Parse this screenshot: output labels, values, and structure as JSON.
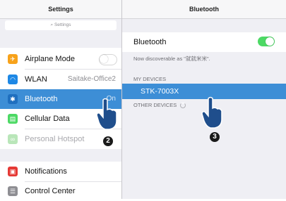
{
  "left_pane": {
    "title": "Settings",
    "search_placeholder": "Settings",
    "rows": [
      {
        "label": "Airplane Mode",
        "value": ""
      },
      {
        "label": "WLAN",
        "value": "Saitake-Office2"
      },
      {
        "label": "Bluetooth",
        "value": "On"
      },
      {
        "label": "Cellular Data",
        "value": ""
      },
      {
        "label": "Personal Hotspot",
        "value": ""
      },
      {
        "label": "Notifications",
        "value": ""
      },
      {
        "label": "Control Center",
        "value": ""
      }
    ],
    "step_badge": "2"
  },
  "right_pane": {
    "title": "Bluetooth",
    "bluetooth_label": "Bluetooth",
    "bluetooth_on": true,
    "discoverable_text": "Now discoverable as \"就就米米\".",
    "my_devices_header": "MY DEVICES",
    "device_name": "STK-7003X",
    "other_devices_header": "OTHER DEVICES",
    "step_badge": "3"
  },
  "colors": {
    "accent_blue": "#4a90d9",
    "selection_blue": "#3d8ed6",
    "toggle_green": "#4cd964"
  },
  "icons": [
    "airplane-icon",
    "wifi-icon",
    "bluetooth-icon",
    "cellular-icon",
    "hotspot-icon",
    "notifications-icon",
    "control-center-icon",
    "tap-hand-icon",
    "spinner-icon"
  ]
}
